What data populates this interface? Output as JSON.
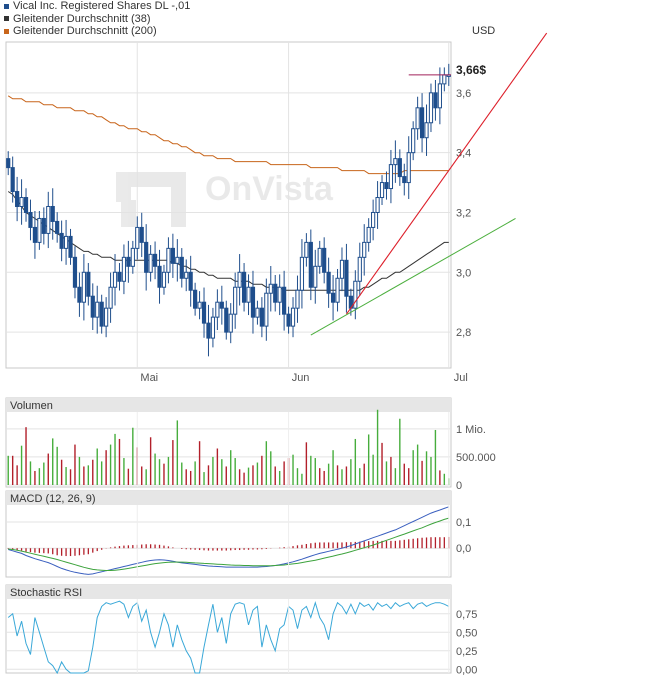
{
  "legend": [
    {
      "label": "Vical Inc. Registered Shares DL -,01",
      "color": "#1f4e8c"
    },
    {
      "label": "Gleitender Durchschnitt (38)",
      "color": "#333333"
    },
    {
      "label": "Gleitender Durchschnitt (200)",
      "color": "#c8651b"
    }
  ],
  "watermark": "OnVista",
  "currency": "USD",
  "colors": {
    "up": "#1f4e8c",
    "ma38": "#333333",
    "ma200": "#c8651b",
    "trend_red": "#dd1f2a",
    "trend_green": "#4caf3e",
    "volume_up": "#46ad3c",
    "volume_down": "#b21f2a",
    "macd_line": "#3a5fbf",
    "signal_line": "#3da33d",
    "histogram": "#b21f2a",
    "stoch": "#3aa8d8",
    "price_marker": "#a0205a"
  },
  "chart_data": [
    {
      "type": "candlestick",
      "title": "Vical Inc. Registered Shares DL -,01",
      "ylabel": "USD",
      "ylim": [
        2.68,
        3.77
      ],
      "y_ticks": [
        "2,8",
        "3,0",
        "3,2",
        "3,4",
        "3,6"
      ],
      "y_tick_values": [
        2.8,
        3.0,
        3.2,
        3.4,
        3.6
      ],
      "x_ticks": [
        "Mai",
        "Jun",
        "Jul"
      ],
      "x_tick_index": [
        29,
        63,
        99
      ],
      "last_price": 3.66,
      "last_price_label": "3,66$",
      "close": [
        3.35,
        3.27,
        3.22,
        3.25,
        3.2,
        3.15,
        3.1,
        3.18,
        3.13,
        3.22,
        3.17,
        3.13,
        3.08,
        3.12,
        3.05,
        2.95,
        2.9,
        3.0,
        2.92,
        2.85,
        2.9,
        2.82,
        2.88,
        2.95,
        3.0,
        2.97,
        3.05,
        3.02,
        3.08,
        3.15,
        3.1,
        3.0,
        3.06,
        3.02,
        2.95,
        3.0,
        3.08,
        3.03,
        3.05,
        2.98,
        3.0,
        2.94,
        2.88,
        2.9,
        2.83,
        2.78,
        2.85,
        2.9,
        2.88,
        2.8,
        2.86,
        2.95,
        3.0,
        2.9,
        2.95,
        2.85,
        2.88,
        2.82,
        2.93,
        2.96,
        2.9,
        2.95,
        2.86,
        2.82,
        2.88,
        2.94,
        3.05,
        3.1,
        2.95,
        3.02,
        3.08,
        3.0,
        2.93,
        2.9,
        2.98,
        3.04,
        2.92,
        2.88,
        2.97,
        3.05,
        3.1,
        3.15,
        3.2,
        3.25,
        3.3,
        3.28,
        3.36,
        3.38,
        3.32,
        3.3,
        3.4,
        3.48,
        3.55,
        3.45,
        3.5,
        3.6,
        3.55,
        3.63,
        3.66,
        3.66
      ],
      "ma38": [
        3.27,
        3.26,
        3.24,
        3.22,
        3.2,
        3.19,
        3.18,
        3.17,
        3.16,
        3.15,
        3.14,
        3.13,
        3.12,
        3.11,
        3.1,
        3.09,
        3.08,
        3.07,
        3.07,
        3.06,
        3.06,
        3.05,
        3.05,
        3.05,
        3.04,
        3.04,
        3.04,
        3.04,
        3.04,
        3.04,
        3.04,
        3.04,
        3.04,
        3.04,
        3.04,
        3.04,
        3.04,
        3.03,
        3.03,
        3.02,
        3.02,
        3.01,
        3.01,
        3.0,
        3.0,
        2.99,
        2.99,
        2.98,
        2.98,
        2.98,
        2.98,
        2.97,
        2.97,
        2.97,
        2.97,
        2.96,
        2.96,
        2.96,
        2.95,
        2.95,
        2.95,
        2.95,
        2.94,
        2.94,
        2.94,
        2.94,
        2.94,
        2.94,
        2.94,
        2.94,
        2.94,
        2.94,
        2.94,
        2.94,
        2.94,
        2.94,
        2.94,
        2.94,
        2.94,
        2.94,
        2.95,
        2.95,
        2.96,
        2.97,
        2.98,
        2.98,
        2.99,
        3.0,
        3.0,
        3.01,
        3.02,
        3.03,
        3.04,
        3.05,
        3.06,
        3.07,
        3.08,
        3.09,
        3.1,
        3.1
      ],
      "ma200": [
        3.59,
        3.58,
        3.58,
        3.58,
        3.57,
        3.57,
        3.57,
        3.57,
        3.56,
        3.56,
        3.56,
        3.55,
        3.55,
        3.55,
        3.55,
        3.54,
        3.54,
        3.54,
        3.53,
        3.53,
        3.52,
        3.52,
        3.51,
        3.5,
        3.5,
        3.49,
        3.49,
        3.48,
        3.48,
        3.48,
        3.47,
        3.47,
        3.46,
        3.46,
        3.45,
        3.44,
        3.44,
        3.43,
        3.43,
        3.42,
        3.42,
        3.41,
        3.4,
        3.4,
        3.39,
        3.39,
        3.39,
        3.38,
        3.38,
        3.38,
        3.38,
        3.37,
        3.37,
        3.37,
        3.37,
        3.37,
        3.37,
        3.37,
        3.37,
        3.36,
        3.36,
        3.36,
        3.36,
        3.36,
        3.36,
        3.36,
        3.36,
        3.36,
        3.35,
        3.35,
        3.35,
        3.35,
        3.35,
        3.35,
        3.35,
        3.34,
        3.34,
        3.34,
        3.34,
        3.34,
        3.34,
        3.33,
        3.33,
        3.33,
        3.33,
        3.33,
        3.33,
        3.33,
        3.33,
        3.34,
        3.34,
        3.34,
        3.34,
        3.34,
        3.34,
        3.34,
        3.34,
        3.34,
        3.34,
        3.34
      ],
      "trend_red": {
        "x": [
          76,
          121
        ],
        "y": [
          2.86,
          3.8
        ]
      },
      "trend_green": {
        "x": [
          68,
          114
        ],
        "y": [
          2.79,
          3.18
        ]
      }
    },
    {
      "type": "bar",
      "title": "Volumen",
      "y_ticks": [
        "1 Mio.",
        "500.000",
        "0"
      ],
      "y_tick_values": [
        1000000,
        500000,
        0
      ],
      "ylim": [
        0,
        1300000
      ],
      "values": [
        520000,
        520000,
        350000,
        700000,
        1030000,
        420000,
        250000,
        300000,
        400000,
        560000,
        830000,
        680000,
        450000,
        320000,
        280000,
        720000,
        500000,
        330000,
        350000,
        450000,
        650000,
        420000,
        620000,
        720000,
        910000,
        820000,
        480000,
        290000,
        1020000,
        670000,
        330000,
        280000,
        850000,
        560000,
        460000,
        380000,
        500000,
        800000,
        1150000,
        400000,
        280000,
        250000,
        420000,
        780000,
        230000,
        350000,
        500000,
        650000,
        460000,
        330000,
        620000,
        480000,
        280000,
        220000,
        310000,
        350000,
        400000,
        520000,
        780000,
        600000,
        330000,
        250000,
        420000,
        480000,
        540000,
        300000,
        200000,
        760000,
        520000,
        480000,
        300000,
        250000,
        380000,
        620000,
        350000,
        280000,
        330000,
        460000,
        820000,
        300000,
        380000,
        900000,
        540000,
        1340000,
        750000,
        420000,
        500000,
        300000,
        1180000,
        380000,
        300000,
        620000,
        720000,
        430000,
        600000,
        500000,
        980000,
        260000,
        200000,
        120000
      ],
      "up": [
        1,
        0,
        0,
        1,
        0,
        1,
        0,
        1,
        1,
        0,
        1,
        1,
        0,
        1,
        0,
        0,
        1,
        0,
        1,
        0,
        1,
        1,
        0,
        1,
        1,
        0,
        1,
        0,
        1,
        0,
        0,
        1,
        0,
        1,
        1,
        0,
        1,
        0,
        1,
        1,
        0,
        0,
        1,
        0,
        1,
        0,
        1,
        0,
        1,
        0,
        1,
        1,
        0,
        0,
        1,
        0,
        1,
        0,
        1,
        1,
        0,
        1,
        0,
        0,
        1,
        1,
        1,
        0,
        1,
        1,
        0,
        0,
        1,
        1,
        0,
        1,
        0,
        1,
        1,
        1,
        0,
        1,
        1,
        1,
        0,
        1,
        0,
        1,
        1,
        0,
        0,
        1,
        1,
        0,
        1,
        1,
        1,
        0,
        1,
        1
      ]
    },
    {
      "type": "line",
      "title": "MACD (12, 26, 9)",
      "y_ticks": [
        "0,1",
        "0,0"
      ],
      "y_tick_values": [
        0.1,
        0.0
      ],
      "ylim": [
        -0.11,
        0.165
      ],
      "series": [
        {
          "values": [
            -0.005,
            -0.01,
            -0.015,
            -0.02,
            -0.028,
            -0.034,
            -0.04,
            -0.045,
            -0.05,
            -0.055,
            -0.062,
            -0.07,
            -0.077,
            -0.083,
            -0.088,
            -0.092,
            -0.095,
            -0.098,
            -0.1,
            -0.098,
            -0.094,
            -0.09,
            -0.086,
            -0.082,
            -0.078,
            -0.074,
            -0.07,
            -0.066,
            -0.062,
            -0.058,
            -0.054,
            -0.05,
            -0.047,
            -0.045,
            -0.044,
            -0.045,
            -0.047,
            -0.05,
            -0.053,
            -0.056,
            -0.058,
            -0.06,
            -0.062,
            -0.064,
            -0.066,
            -0.068,
            -0.069,
            -0.07,
            -0.071,
            -0.072,
            -0.072,
            -0.072,
            -0.072,
            -0.072,
            -0.072,
            -0.072,
            -0.072,
            -0.071,
            -0.07,
            -0.068,
            -0.066,
            -0.063,
            -0.06,
            -0.056,
            -0.052,
            -0.047,
            -0.042,
            -0.036,
            -0.03,
            -0.025,
            -0.02,
            -0.016,
            -0.012,
            -0.008,
            -0.004,
            0.0,
            0.005,
            0.01,
            0.016,
            0.022,
            0.028,
            0.034,
            0.04,
            0.046,
            0.052,
            0.058,
            0.064,
            0.07,
            0.078,
            0.086,
            0.094,
            0.102,
            0.11,
            0.118,
            0.126,
            0.134,
            0.14,
            0.146,
            0.152,
            0.158
          ]
        },
        {
          "values": [
            -0.003,
            -0.005,
            -0.008,
            -0.011,
            -0.015,
            -0.019,
            -0.023,
            -0.027,
            -0.031,
            -0.035,
            -0.039,
            -0.043,
            -0.048,
            -0.053,
            -0.058,
            -0.063,
            -0.068,
            -0.073,
            -0.077,
            -0.081,
            -0.083,
            -0.084,
            -0.085,
            -0.085,
            -0.084,
            -0.082,
            -0.08,
            -0.077,
            -0.074,
            -0.071,
            -0.068,
            -0.065,
            -0.062,
            -0.059,
            -0.057,
            -0.055,
            -0.054,
            -0.053,
            -0.053,
            -0.053,
            -0.054,
            -0.055,
            -0.056,
            -0.057,
            -0.058,
            -0.059,
            -0.06,
            -0.061,
            -0.062,
            -0.063,
            -0.064,
            -0.065,
            -0.065,
            -0.066,
            -0.066,
            -0.067,
            -0.067,
            -0.067,
            -0.067,
            -0.067,
            -0.066,
            -0.065,
            -0.064,
            -0.062,
            -0.06,
            -0.058,
            -0.055,
            -0.052,
            -0.049,
            -0.046,
            -0.042,
            -0.038,
            -0.034,
            -0.03,
            -0.026,
            -0.022,
            -0.018,
            -0.013,
            -0.008,
            -0.003,
            0.002,
            0.007,
            0.012,
            0.018,
            0.024,
            0.03,
            0.036,
            0.042,
            0.048,
            0.054,
            0.06,
            0.066,
            0.072,
            0.078,
            0.085,
            0.092,
            0.098,
            0.104,
            0.11,
            0.115
          ]
        }
      ],
      "histogram": [
        -0.002,
        -0.005,
        -0.007,
        -0.009,
        -0.013,
        -0.015,
        -0.017,
        -0.018,
        -0.019,
        -0.02,
        -0.023,
        -0.027,
        -0.029,
        -0.03,
        -0.03,
        -0.029,
        -0.027,
        -0.025,
        -0.023,
        -0.017,
        -0.011,
        -0.006,
        -0.001,
        0.003,
        0.006,
        0.008,
        0.01,
        0.011,
        0.012,
        0.013,
        0.014,
        0.015,
        0.015,
        0.014,
        0.013,
        0.01,
        0.007,
        0.003,
        0.0,
        -0.003,
        -0.004,
        -0.005,
        -0.006,
        -0.007,
        -0.008,
        -0.009,
        -0.009,
        -0.009,
        -0.009,
        -0.009,
        -0.008,
        -0.007,
        -0.007,
        -0.006,
        -0.006,
        -0.005,
        -0.005,
        -0.004,
        -0.003,
        -0.001,
        0.0,
        0.002,
        0.004,
        0.006,
        0.008,
        0.011,
        0.013,
        0.016,
        0.019,
        0.021,
        0.022,
        0.022,
        0.022,
        0.022,
        0.022,
        0.022,
        0.023,
        0.023,
        0.024,
        0.025,
        0.026,
        0.027,
        0.028,
        0.028,
        0.028,
        0.028,
        0.028,
        0.028,
        0.03,
        0.032,
        0.034,
        0.036,
        0.038,
        0.04,
        0.041,
        0.042,
        0.042,
        0.042,
        0.042,
        0.043
      ]
    },
    {
      "type": "line",
      "title": "Stochastic RSI",
      "y_ticks": [
        "0,75",
        "0,50",
        "0,25",
        "0,00"
      ],
      "y_tick_values": [
        0.75,
        0.5,
        0.25,
        0.0
      ],
      "ylim": [
        -0.05,
        0.95
      ],
      "values": [
        0.7,
        0.75,
        0.45,
        0.65,
        0.35,
        0.2,
        0.7,
        0.5,
        0.3,
        0.1,
        0.05,
        -0.05,
        0.1,
        0.0,
        -0.05,
        -0.05,
        -0.05,
        -0.05,
        -0.02,
        0.3,
        0.7,
        0.85,
        0.9,
        0.88,
        0.9,
        0.92,
        0.88,
        0.7,
        0.85,
        0.9,
        0.65,
        0.8,
        0.5,
        0.3,
        0.5,
        0.75,
        0.6,
        0.3,
        0.6,
        0.4,
        0.25,
        0.15,
        -0.05,
        -0.05,
        0.3,
        0.6,
        0.88,
        0.5,
        0.7,
        0.35,
        0.75,
        0.88,
        0.9,
        0.88,
        0.6,
        0.8,
        0.85,
        0.3,
        0.6,
        0.4,
        0.25,
        0.55,
        0.6,
        0.85,
        0.8,
        0.55,
        0.8,
        0.85,
        0.7,
        0.9,
        0.7,
        0.6,
        0.4,
        0.75,
        0.9,
        0.85,
        0.75,
        0.88,
        0.75,
        0.9,
        0.85,
        0.88,
        0.8,
        0.9,
        0.85,
        0.88,
        0.82,
        0.9,
        0.85,
        0.88,
        0.9,
        0.82,
        0.88,
        0.9,
        0.85,
        0.88,
        0.9,
        0.9,
        0.88,
        0.85
      ]
    }
  ]
}
